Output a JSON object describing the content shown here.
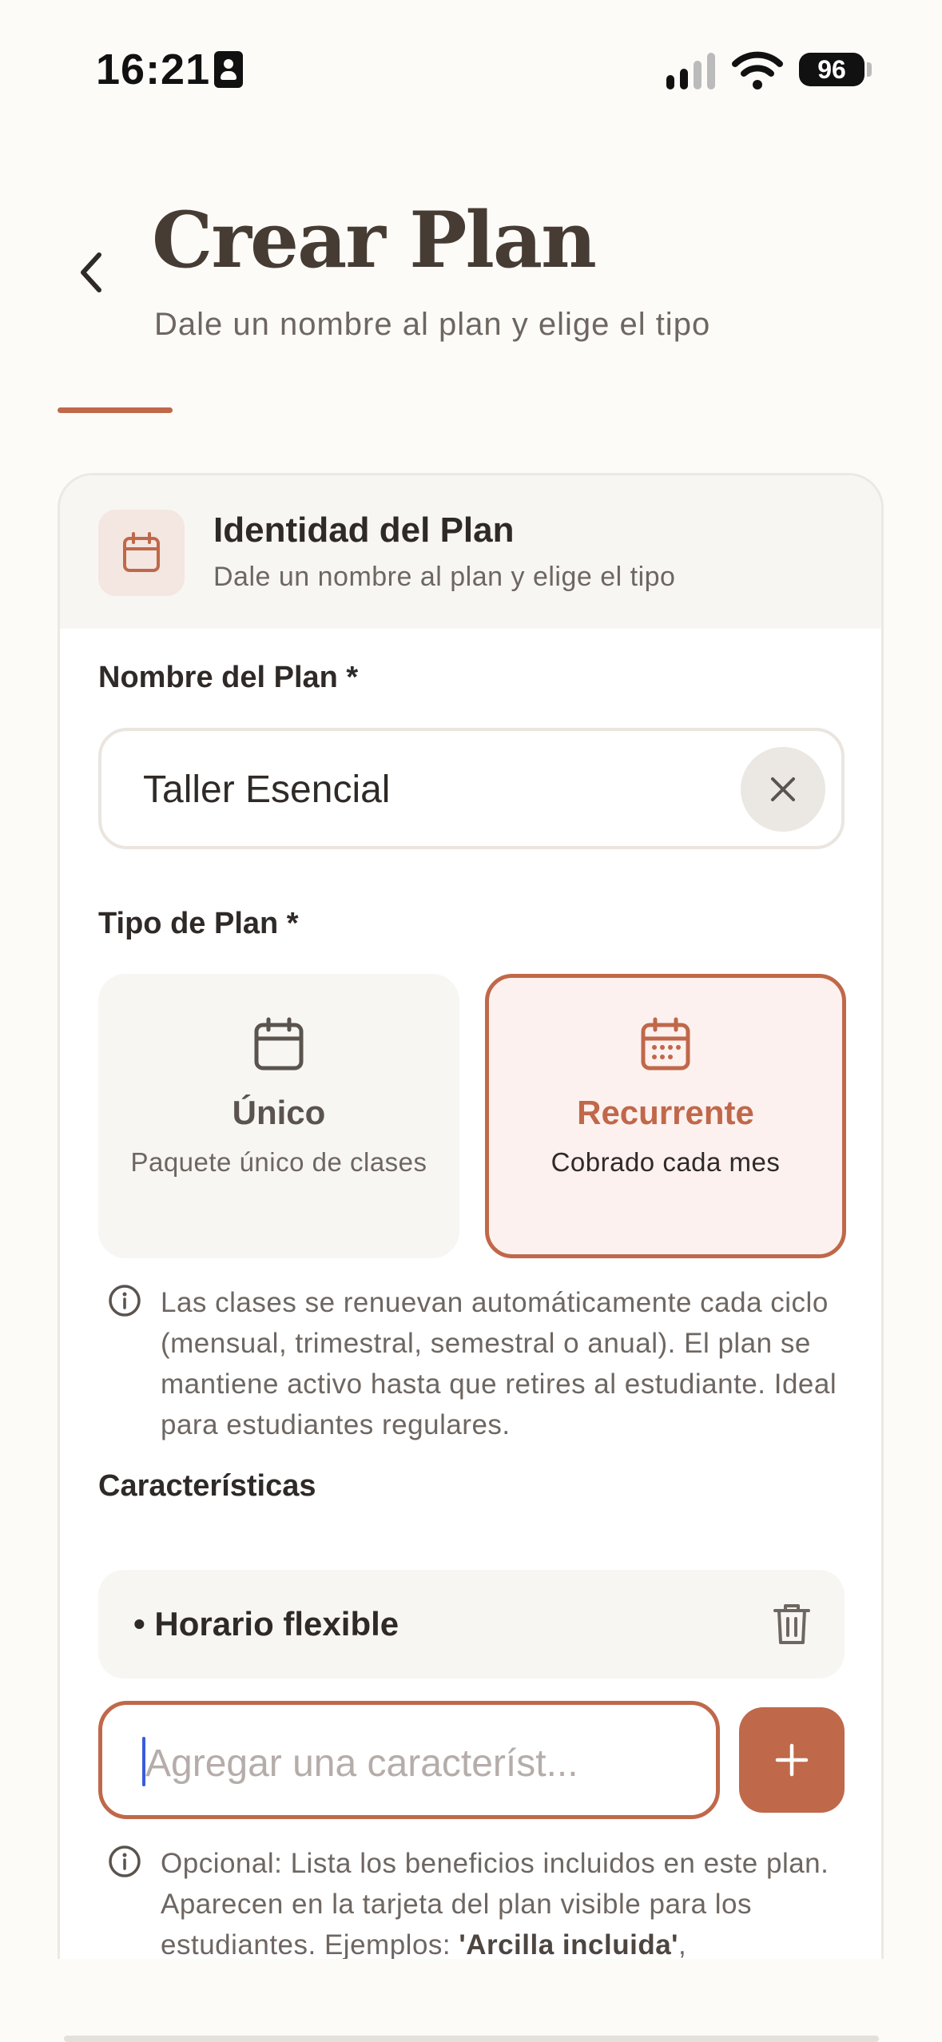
{
  "status_bar": {
    "time": "16:21",
    "battery": "96"
  },
  "header": {
    "title": "Crear Plan",
    "subtitle": "Dale un nombre al plan y elige el tipo"
  },
  "card": {
    "title": "Identidad del Plan",
    "subtitle": "Dale un nombre al plan y elige el tipo"
  },
  "name_field": {
    "label": "Nombre del Plan *",
    "value": "Taller Esencial"
  },
  "plan_type": {
    "label": "Tipo de Plan *",
    "selected": "Recurrente",
    "options": [
      {
        "title": "Único",
        "description": "Paquete único de clases"
      },
      {
        "title": "Recurrente",
        "description": "Cobrado cada mes"
      }
    ],
    "info": "Las clases se renuevan automáticamente cada ciclo (mensual, trimestral, semestral o anual). El plan se mantiene activo hasta que retires al estudiante. Ideal para estudiantes regulares."
  },
  "features": {
    "label": "Características",
    "items": [
      "• Horario flexible"
    ],
    "input_placeholder": "Agregar una característ...",
    "help_prefix": "Opcional: Lista los beneficios incluidos en este plan. Aparecen en la tarjeta del plan visible para los estudiantes. Ejemplos: ",
    "help_example": "'Arcilla incluida'",
    "help_suffix": ","
  },
  "colors": {
    "accent": "#c0684a",
    "background": "#fcfbf8",
    "title": "#473c34"
  },
  "icons": [
    "person-card-icon",
    "cellular-signal-icon",
    "wifi-icon",
    "battery-icon",
    "back-chevron-icon",
    "calendar-icon",
    "clear-x-icon",
    "calendar-days-icon",
    "info-icon",
    "trash-icon",
    "plus-icon"
  ]
}
